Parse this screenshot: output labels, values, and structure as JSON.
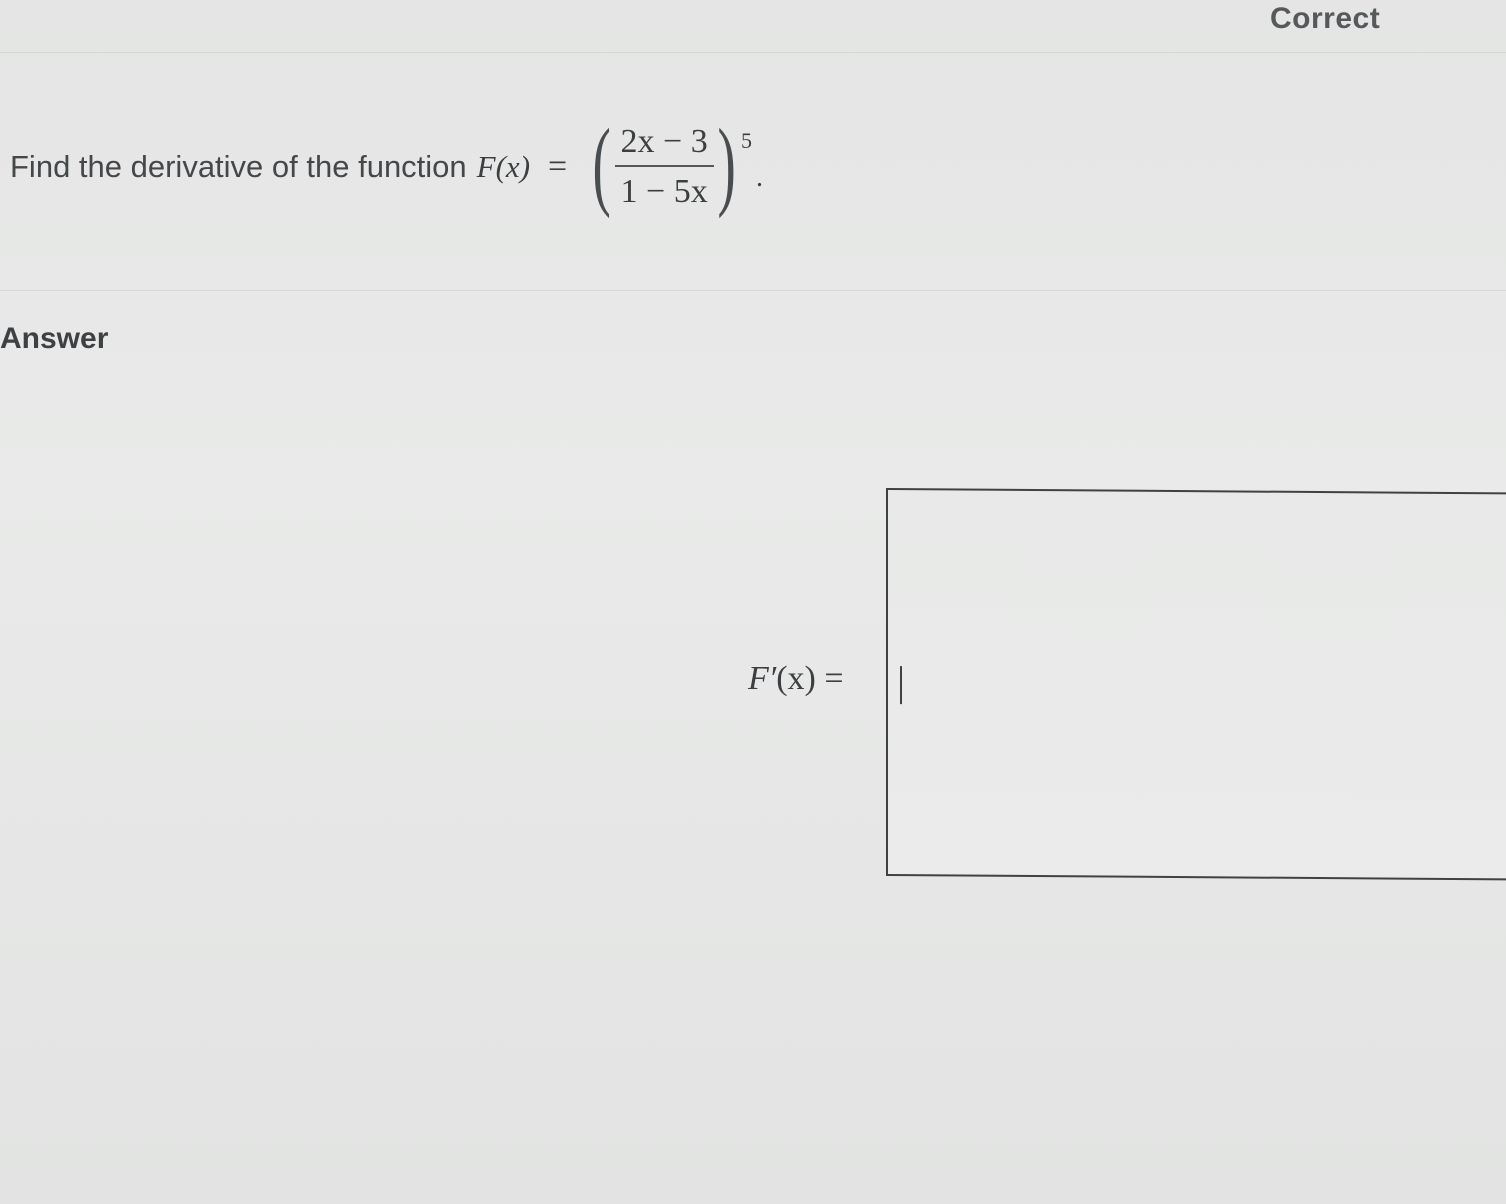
{
  "header": {
    "status": "Correct"
  },
  "question": {
    "prompt": "Find the derivative of the function",
    "func_name": "F",
    "open_paren_var": "(x)",
    "equals": "=",
    "numerator": "2x − 3",
    "denominator": "1 − 5x",
    "exponent": "5",
    "period": "."
  },
  "answer": {
    "heading": "Answer",
    "label_func": "F′",
    "label_var": "(x)",
    "label_equals": "=",
    "input_value": ""
  }
}
